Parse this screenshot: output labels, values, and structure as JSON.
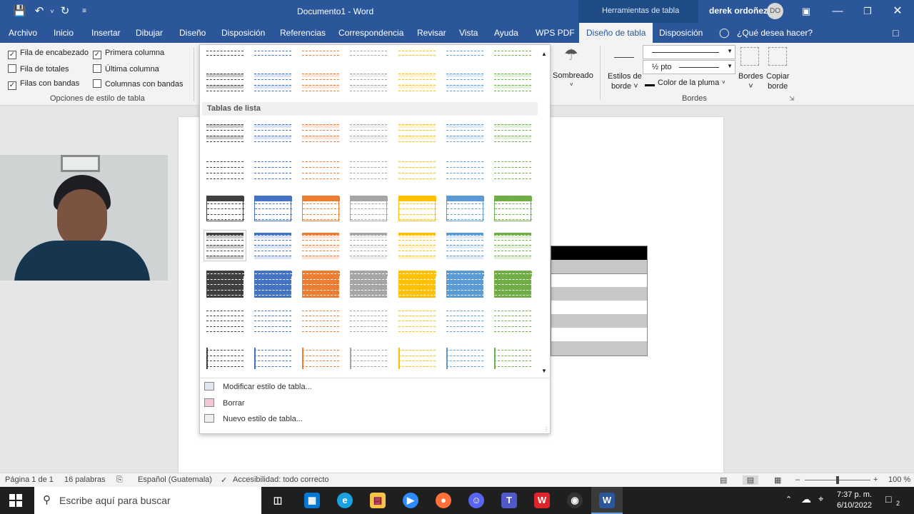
{
  "title_bar": {
    "document_title": "Documento1  -  Word",
    "tool_context": "Herramientas de tabla",
    "user_name": "derek ordoñez",
    "user_initials": "DO"
  },
  "tabs": [
    {
      "label": "Archivo"
    },
    {
      "label": "Inicio"
    },
    {
      "label": "Insertar"
    },
    {
      "label": "Dibujar"
    },
    {
      "label": "Diseño"
    },
    {
      "label": "Disposición"
    },
    {
      "label": "Referencias"
    },
    {
      "label": "Correspondencia"
    },
    {
      "label": "Revisar"
    },
    {
      "label": "Vista"
    },
    {
      "label": "Ayuda"
    },
    {
      "label": "WPS PDF"
    },
    {
      "label": "Diseño de tabla",
      "active": true
    },
    {
      "label": "Disposición"
    }
  ],
  "tell_me": "¿Qué desea hacer?",
  "style_options": {
    "group_label": "Opciones de estilo de tabla",
    "items": [
      {
        "label": "Fila de encabezado",
        "checked": true
      },
      {
        "label": "Primera columna",
        "checked": true
      },
      {
        "label": "Fila de totales",
        "checked": false
      },
      {
        "label": "Última columna",
        "checked": false
      },
      {
        "label": "Filas con bandas",
        "checked": true
      },
      {
        "label": "Columnas con bandas",
        "checked": false
      }
    ]
  },
  "borders_group": {
    "shading_label": "Sombreado",
    "border_styles_label": "Estilos de borde",
    "border_styles_line1": "Estilos de",
    "border_styles_line2": "borde",
    "pen_weight": "½ pto",
    "pen_color_label": "Color de la pluma",
    "borders_label": "Bordes",
    "copy_border_line1": "Copiar",
    "copy_border_line2": "borde",
    "group_label": "Bordes"
  },
  "gallery": {
    "section_title": "Tablas de lista",
    "colors": [
      "#404040",
      "#4472c4",
      "#ed7d31",
      "#a5a5a5",
      "#ffc000",
      "#5b9bd5",
      "#70ad47"
    ],
    "light_colors": [
      "#c9c9c9",
      "#d9e2f3",
      "#fbe4d5",
      "#ededed",
      "#fff2cc",
      "#deeaf6",
      "#e2efd9"
    ],
    "menu": [
      {
        "label": "Modificar estilo de tabla...",
        "icon": "table-edit-icon"
      },
      {
        "label": "Borrar",
        "icon": "eraser-icon"
      },
      {
        "label": "Nuevo estilo de tabla...",
        "icon": "new-table-style-icon"
      }
    ]
  },
  "status_bar": {
    "page": "Página 1 de 1",
    "words": "16 palabras",
    "language": "Español (Guatemala)",
    "accessibility": "Accesibilidad: todo correcto",
    "zoom": "100 %"
  },
  "taskbar": {
    "search_placeholder": "Escribe aquí para buscar",
    "time": "7:37 p. m.",
    "date": "6/10/2022",
    "notification_count": "2"
  }
}
